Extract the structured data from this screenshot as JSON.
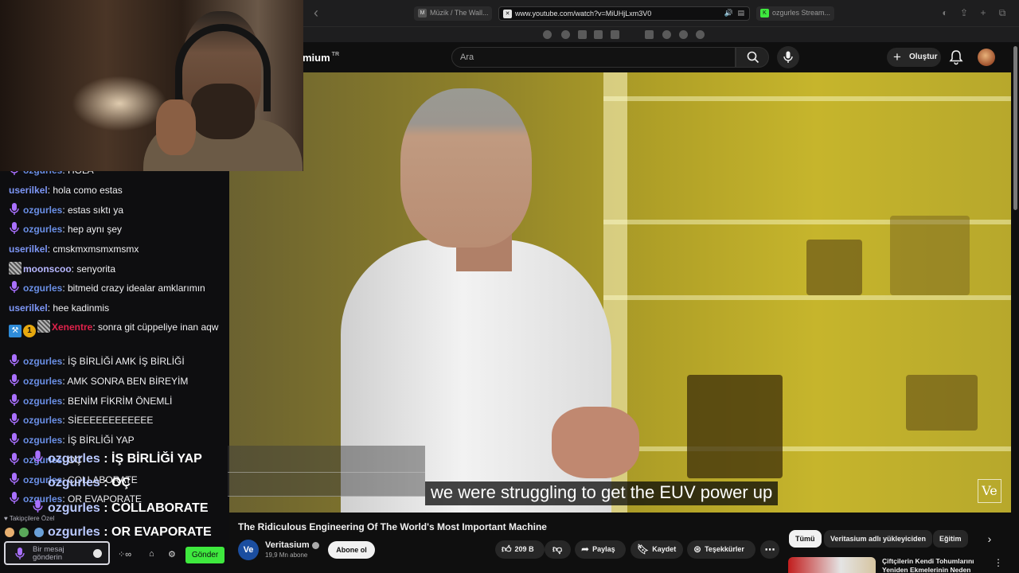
{
  "browser": {
    "tabs": [
      {
        "label": "Müzik / The Wall..."
      },
      {
        "label": "www.youtube.com/watch?v=MiUHjLxm3V0"
      },
      {
        "label": "ozgurles Stream..."
      }
    ]
  },
  "youtube": {
    "logo": "mium",
    "logo_sup": "TR",
    "search_placeholder": "Ara",
    "create_label": "Oluştur"
  },
  "video": {
    "caption": "we were struggling to get the EUV power up",
    "watermark": "Ve",
    "title": "The Ridiculous Engineering Of The World's Most Important Machine",
    "channel": {
      "avatar_text": "Ve",
      "name": "Veritasium",
      "subscribers": "19,9 Mn abone",
      "subscribe_label": "Abone ol"
    },
    "actions": {
      "likes": "209 B",
      "share": "Paylaş",
      "save": "Kaydet",
      "thanks": "Teşekkürler"
    },
    "chips": [
      "Tümü",
      "Veritasium adlı yükleyiciden",
      "Eğitim"
    ],
    "recommendation_title": "Çiftçilerin Kendi Tohumlarını Yeniden Ekmelerinin Neden"
  },
  "chat": {
    "messages": [
      {
        "user": "ozgurles",
        "text": ": HOLA"
      },
      {
        "user": "userilkel",
        "text": ": hola como estas"
      },
      {
        "user": "ozgurles",
        "text": ": estas sıktı ya"
      },
      {
        "user": "ozgurles",
        "text": ": hep aynı şey"
      },
      {
        "user": "userilkel",
        "text": ": cmskmxmsmxmsmx"
      },
      {
        "user": "moonscoo",
        "text": ": senyorita"
      },
      {
        "user": "ozgurles",
        "text": ": bitmeid crazy idealar amklarımın"
      },
      {
        "user": "userilkel",
        "text": ": hee kadinmis"
      },
      {
        "user": "Xenentre",
        "text": ": sonra git cüppeliye inan aqw"
      },
      {
        "user": "ozgurles",
        "text": ": İŞ BİRLİĞİ AMK İŞ BİRLİĞİ"
      },
      {
        "user": "ozgurles",
        "text": ": AMK SONRA BEN BİREYİM"
      },
      {
        "user": "ozgurles",
        "text": ": BENİM FİKRİM ÖNEMLİ"
      },
      {
        "user": "ozgurles",
        "text": ": SİEEEEEEEEEEEE"
      },
      {
        "user": "ozgurles",
        "text": ": İŞ BİRLİĞİ YAP"
      },
      {
        "user": "ozgurles",
        "text": ": OÇ"
      },
      {
        "user": "ozgurles",
        "text": ": COLLABORATE"
      },
      {
        "user": "ozgurles",
        "text": ": OR EVAPORATE"
      }
    ],
    "badge_gold": "1",
    "overlay": [
      {
        "user": "ozgurles",
        "text": " : İŞ BİRLİĞİ YAP"
      },
      {
        "user": "ozgurles",
        "text": " : OÇ"
      },
      {
        "user": "ozgurles",
        "text": " : COLLABORATE"
      },
      {
        "user": "ozgurles",
        "text": " : OR EVAPORATE"
      }
    ],
    "followers_only": "Takipçilere Özel",
    "input_placeholder": "Bir mesaj gönderin",
    "send_label": "Gönder"
  },
  "colors": {
    "send_button": "#3ee83e",
    "streamer_name": "#6a8fe6",
    "user_name": "#7d96f6",
    "red_name": "#e0224b"
  }
}
